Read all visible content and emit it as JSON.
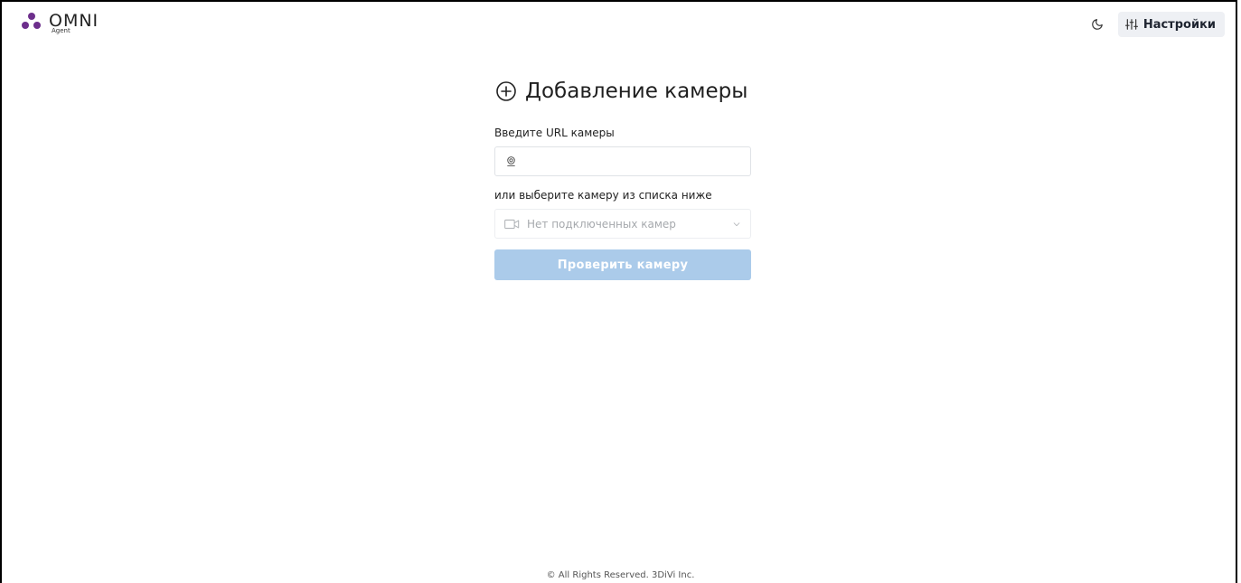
{
  "brand": {
    "name": "OMNI",
    "subtitle": "Agent",
    "color": "#6d2f8c"
  },
  "header": {
    "theme_toggle_icon": "moon-icon",
    "settings_label": "Настройки",
    "settings_icon": "sliders-icon"
  },
  "main": {
    "title": "Добавление камеры",
    "title_icon": "plus-circle-icon",
    "url_label": "Введите URL камеры",
    "url_value": "",
    "url_icon": "webcam-icon",
    "list_label": "или выберите камеру из списка ниже",
    "select_value": "Нет подключенных камер",
    "select_icon": "video-camera-icon",
    "check_button": "Проверить камеру",
    "check_button_color": "#abcbea"
  },
  "footer": {
    "text": "© All Rights Reserved. 3DiVi Inc."
  }
}
